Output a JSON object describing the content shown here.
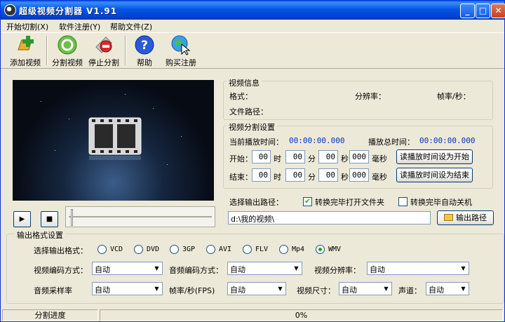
{
  "window": {
    "title": "超级视频分割器 V1.91"
  },
  "menu": [
    "开始切割(X)",
    "软件注册(Y)",
    "帮助文件(Z)"
  ],
  "toolbar": {
    "add": "添加视频",
    "split": "分割视频",
    "stop": "停止分割",
    "help": "帮助",
    "buy": "购买注册"
  },
  "video_info": {
    "legend": "视频信息",
    "format": "格式：",
    "resolution": "分辨率：",
    "fps": "帧率/秒：",
    "path": "文件路径："
  },
  "split_settings": {
    "legend": "视频分割设置",
    "current_time_label": "当前播放时间：",
    "current_time": "00:00:00.000",
    "total_time_label": "播放总时间：",
    "total_time": "00:00:00.000",
    "start_label": "开始：",
    "end_label": "结束：",
    "start": {
      "h": "00",
      "m": "00",
      "s": "00",
      "ms": "000"
    },
    "end": {
      "h": "00",
      "m": "00",
      "s": "00",
      "ms": "000"
    },
    "unit_h": "时",
    "unit_m": "分",
    "unit_s": "秒",
    "unit_ms": "毫秒",
    "set_start_btn": "读播放时间设为开始",
    "set_end_btn": "读播放时间设为结束"
  },
  "output": {
    "path_label": "选择输出路径：",
    "open_folder_label": "转换完毕打开文件夹",
    "open_folder_checked": true,
    "shutdown_label": "转换完毕自动关机",
    "shutdown_checked": false,
    "path_value": "d:\\我的视频\\",
    "path_button": "输出路径"
  },
  "format_settings": {
    "legend": "输出格式设置",
    "select_label": "选择输出格式：",
    "formats": [
      "VCD",
      "DVD",
      "3GP",
      "AVI",
      "FLV",
      "Mp4",
      "WMV"
    ],
    "selected": "WMV",
    "video_codec_label": "视频编码方式：",
    "video_codec": "自动",
    "audio_codec_label": "音频编码方式：",
    "audio_codec": "自动",
    "video_res_label": "视频分辨率：",
    "video_res": "自动",
    "sample_rate_label": "音频采样率",
    "sample_rate": "自动",
    "fps_label": "帧率/秒(FPS)",
    "fps": "自动",
    "size_label": "视频尺寸：",
    "size": "自动",
    "channel_label": "声道：",
    "channel": "自动"
  },
  "status": {
    "label": "分割进度",
    "progress": "0%",
    "progress_value": 0
  }
}
